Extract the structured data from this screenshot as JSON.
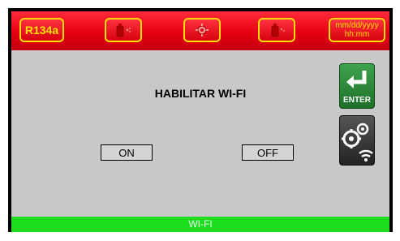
{
  "header": {
    "gas_label": "R134a",
    "icons": [
      "tank-icon",
      "settings-gear-icon",
      "tank-fill-icon"
    ],
    "datetime_line1": "mm/dd/yyyy",
    "datetime_line2": "hh:mm"
  },
  "main": {
    "title": "HABILITAR WI-FI",
    "on_label": "ON",
    "off_label": "OFF"
  },
  "side": {
    "enter_label": "ENTER",
    "settings_icon": "gears-wifi-icon"
  },
  "footer": {
    "label": "WI-FI"
  },
  "colors": {
    "header_red": "#e50012",
    "accent_yellow": "#ffe000",
    "panel_gray": "#c8c8c8",
    "footer_green": "#1edc1e",
    "enter_green": "#2e8b3a"
  }
}
